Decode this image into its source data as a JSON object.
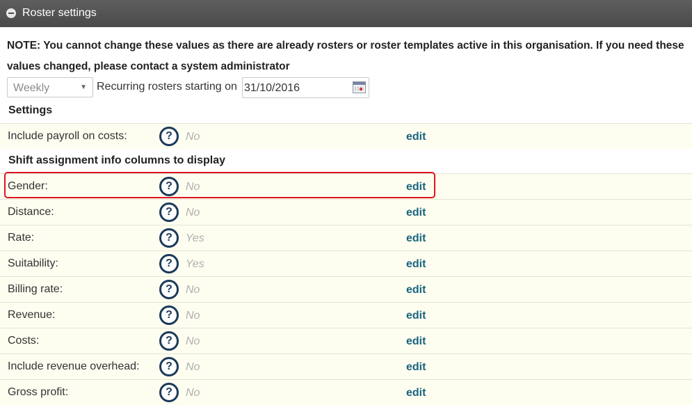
{
  "panel": {
    "title": "Roster settings"
  },
  "note": "NOTE: You cannot change these values as there are already rosters or roster templates active in this organisation. If you need these values changed, please contact a system administrator",
  "recurrence": {
    "frequency": "Weekly",
    "label": "Recurring rosters starting on",
    "start_date": "31/10/2016"
  },
  "sections": {
    "settings": "Settings",
    "shift_columns": "Shift assignment info columns to display"
  },
  "edit_label": "edit",
  "settings_rows": [
    {
      "label": "Include payroll on costs:",
      "value": "No"
    }
  ],
  "column_rows": [
    {
      "label": "Gender:",
      "value": "No"
    },
    {
      "label": "Distance:",
      "value": "No"
    },
    {
      "label": "Rate:",
      "value": "Yes"
    },
    {
      "label": "Suitability:",
      "value": "Yes"
    },
    {
      "label": "Billing rate:",
      "value": "No"
    },
    {
      "label": "Revenue:",
      "value": "No"
    },
    {
      "label": "Costs:",
      "value": "No"
    },
    {
      "label": "Include revenue overhead:",
      "value": "No"
    },
    {
      "label": "Gross profit:",
      "value": "No"
    }
  ],
  "highlight_color": "#e0141e"
}
